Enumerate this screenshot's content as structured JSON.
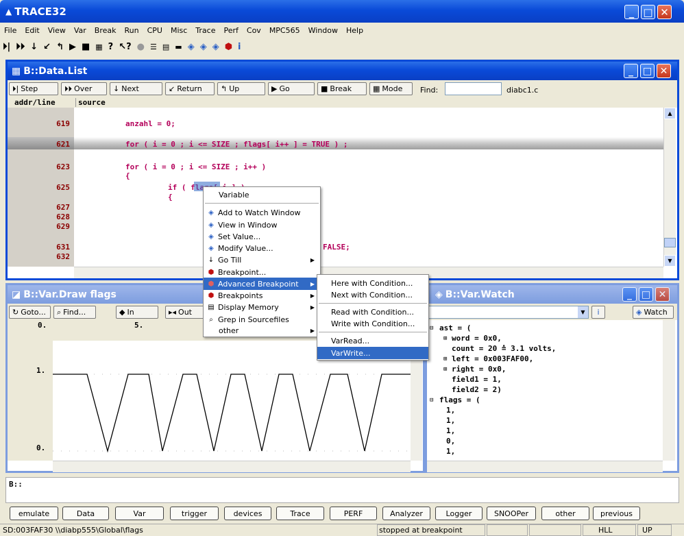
{
  "app": {
    "title": "TRACE32"
  },
  "menubar": [
    "File",
    "Edit",
    "View",
    "Var",
    "Break",
    "Run",
    "CPU",
    "Misc",
    "Trace",
    "Perf",
    "Cov",
    "MPC565",
    "Window",
    "Help"
  ],
  "datalist": {
    "title": "B::Data.List",
    "buttons": [
      "Step",
      "Over",
      "Next",
      "Return",
      "Up",
      "Go",
      "Break",
      "Mode"
    ],
    "find_label": "Find:",
    "find_value": "",
    "module": "diabc1.c",
    "col_addr": "addr/line",
    "col_source": "source",
    "rows": [
      {
        "line": "619",
        "src": "anzahl = 0;"
      },
      {
        "line": "621",
        "src": "for ( i = 0 ; i <= SIZE ; flags[ i++ ] = TRUE ) ;"
      },
      {
        "line": "623",
        "src": "for ( i = 0 ; i <= SIZE ; i++ )"
      },
      {
        "line": "",
        "src": "{"
      },
      {
        "line": "625",
        "src": "if ( flags[ i ] )"
      },
      {
        "line": "",
        "src": "{"
      },
      {
        "line": "627",
        "src": ""
      },
      {
        "line": "628",
        "src": ""
      },
      {
        "line": "629",
        "src": ""
      },
      {
        "line": "631",
        "src": "FALSE;"
      },
      {
        "line": "632",
        "src": ""
      }
    ]
  },
  "vardraw": {
    "title": "B::Var.Draw flags",
    "buttons": [
      "Goto...",
      "Find...",
      "In",
      "Out"
    ],
    "x_ticks": [
      "0.",
      "5."
    ],
    "y_ticks": [
      "1.",
      "0."
    ]
  },
  "varwatch": {
    "title": "B::Var.Watch",
    "watch_label": "Watch",
    "lines": [
      "ast = (",
      "word = 0x0,",
      "count = 20 ≙ 3.1 volts,",
      "left = 0x003FAF00,",
      "right = 0x0,",
      "field1 = 1,",
      "field2 = 2)",
      "flags = (",
      "1,",
      "1,",
      "1,",
      "0,",
      "1,"
    ]
  },
  "context_menu": {
    "header": "Variable",
    "items": [
      "Add to Watch Window",
      "View in Window",
      "Set Value...",
      "Modify Value...",
      "Go Till",
      "Breakpoint...",
      "Advanced Breakpoint",
      "Breakpoints",
      "Display Memory",
      "Grep in Sourcefiles",
      "other"
    ]
  },
  "submenu": {
    "items": [
      "Here with Condition...",
      "Next with Condition...",
      "Read with Condition...",
      "Write with Condition...",
      "VarRead...",
      "VarWrite..."
    ]
  },
  "command": {
    "prompt": "B::"
  },
  "bottom_buttons": [
    "emulate",
    "Data",
    "Var",
    "trigger",
    "devices",
    "Trace",
    "PERF",
    "Analyzer",
    "Logger",
    "SNOOPer",
    "other",
    "previous"
  ],
  "status": {
    "path": "SD:003FAF30 \\\\diabp555\\Global\\flags",
    "state": "stopped at breakpoint",
    "mode": "HLL",
    "up": "UP"
  }
}
